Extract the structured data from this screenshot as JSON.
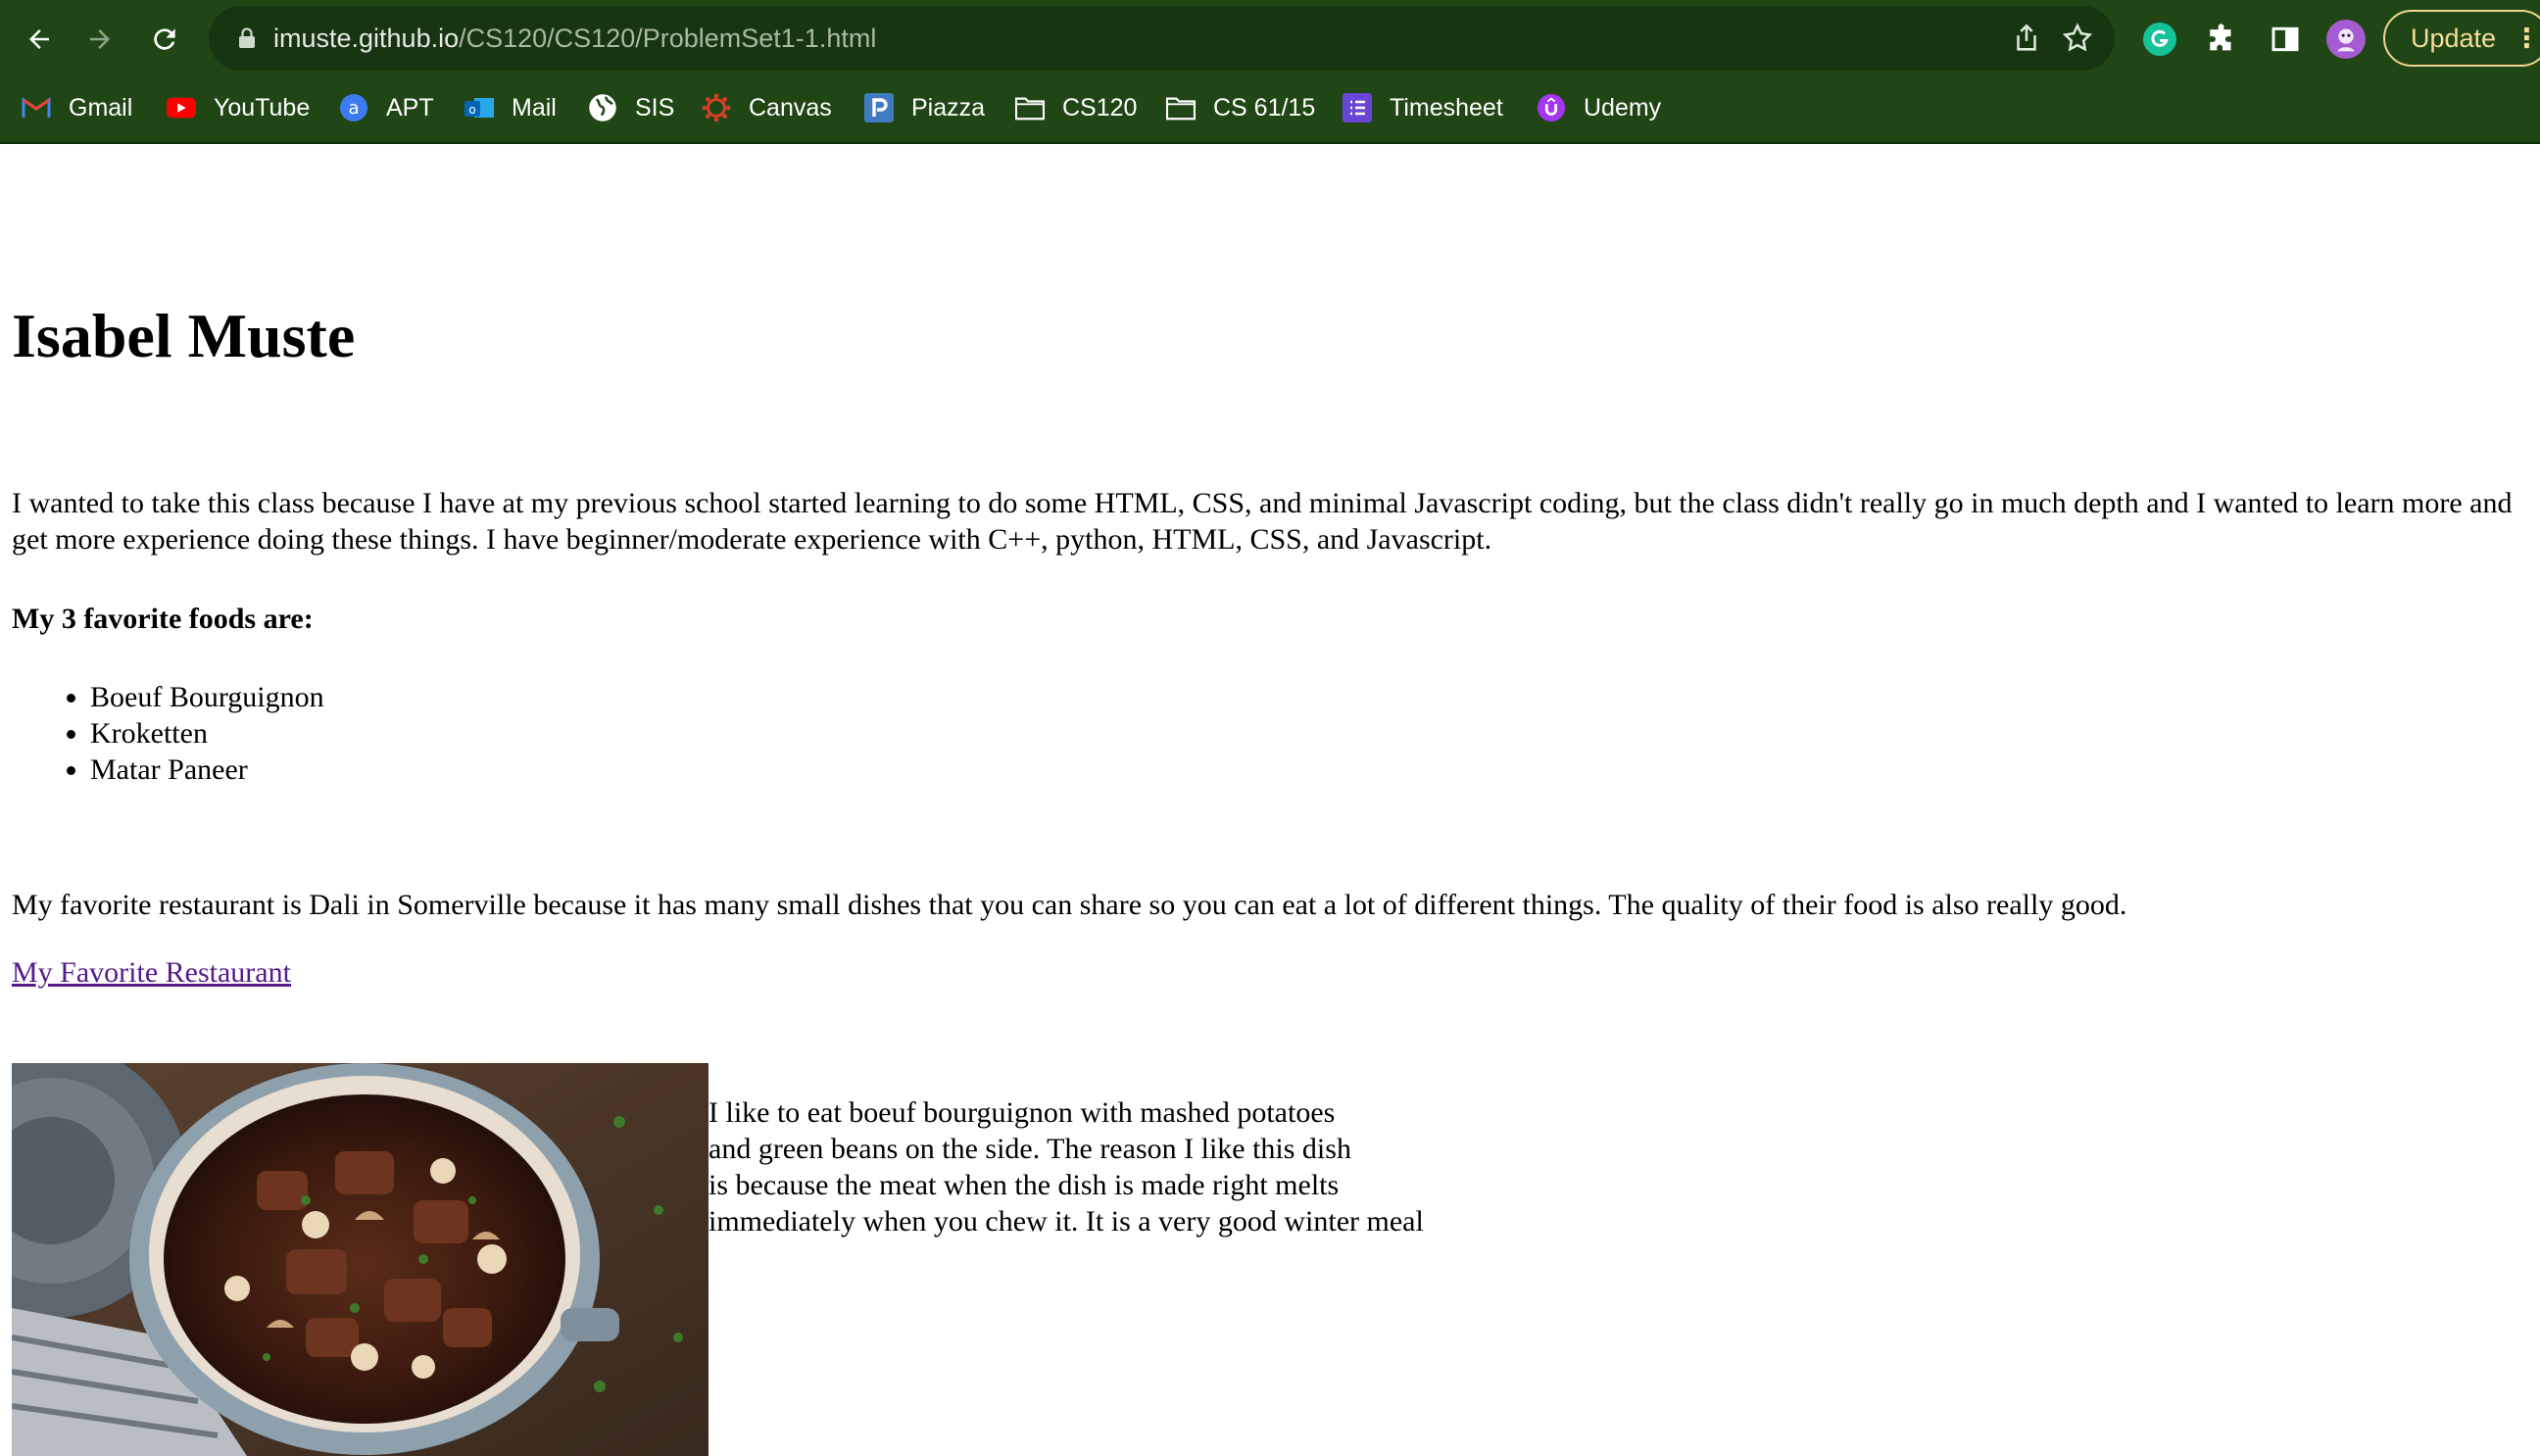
{
  "browser": {
    "url_host": "imuste.github.io",
    "url_path": "/CS120/CS120/ProblemSet1-1.html",
    "update_label": "Update",
    "icons": [
      "back-arrow-icon",
      "forward-arrow-icon",
      "reload-icon",
      "lock-icon",
      "share-icon",
      "star-icon",
      "grammarly-icon",
      "extensions-puzzle-icon",
      "side-panel-icon",
      "profile-avatar-icon",
      "kebab-menu-icon"
    ]
  },
  "bookmarks": [
    {
      "label": "Gmail",
      "icon": "gmail-icon"
    },
    {
      "label": "YouTube",
      "icon": "youtube-icon"
    },
    {
      "label": "APT",
      "icon": "apt-icon"
    },
    {
      "label": "Mail",
      "icon": "outlook-mail-icon"
    },
    {
      "label": "SIS",
      "icon": "globe-icon"
    },
    {
      "label": "Canvas",
      "icon": "canvas-icon"
    },
    {
      "label": "Piazza",
      "icon": "piazza-icon"
    },
    {
      "label": "CS120",
      "icon": "folder-icon"
    },
    {
      "label": "CS 61/15",
      "icon": "folder-icon"
    },
    {
      "label": "Timesheet",
      "icon": "timesheet-icon"
    },
    {
      "label": "Udemy",
      "icon": "udemy-icon"
    }
  ],
  "page": {
    "title": "Isabel Muste",
    "intro": "I wanted to take this class because I have at my previous school started learning to do some HTML, CSS, and minimal Javascript coding, but the class didn't really go in much depth and I wanted to learn more and get more experience doing these things. I have beginner/moderate experience with C++, python, HTML, CSS, and Javascript.",
    "foods_heading": "My 3 favorite foods are:",
    "foods": [
      "Boeuf Bourguignon",
      "Kroketten",
      "Matar Paneer"
    ],
    "restaurant_text": "My favorite restaurant is Dali in Somerville because it has many small dishes that you can share so you can eat a lot of different things. The quality of their food is also really good.",
    "restaurant_link": "My Favorite Restaurant",
    "dish_text": "I like to eat boeuf bourguignon with mashed potatoes\nand green beans on the side. The reason I like this dish\nis because the meat when the dish is made right melts\nimmediately when you chew it. It is a very good winter meal"
  },
  "colors": {
    "chrome": "#1f4614",
    "omnibox": "#173510",
    "link_visited": "#551a8b",
    "update_accent": "#f2d58f"
  }
}
